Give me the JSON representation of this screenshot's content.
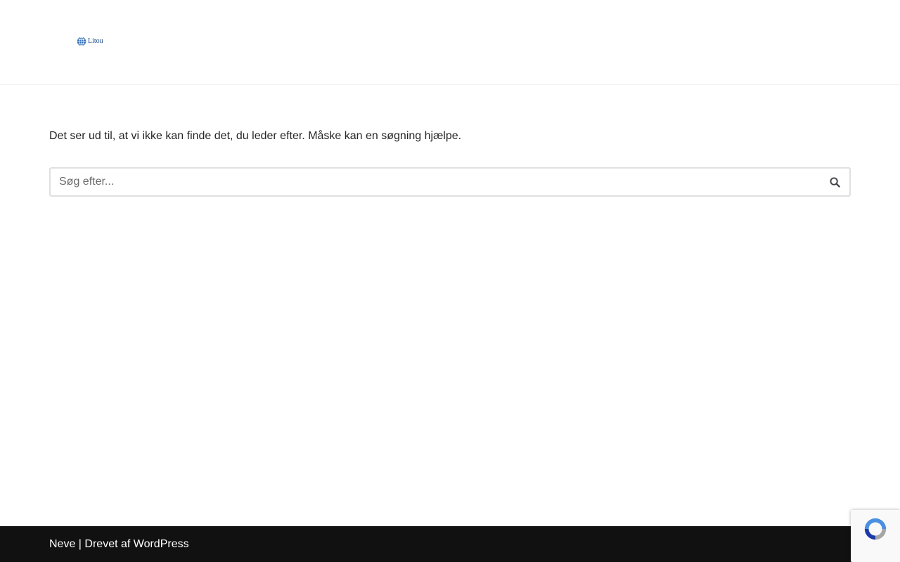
{
  "header": {
    "logo_text": "Litou",
    "logo_color": "#1f4e8c"
  },
  "main": {
    "message": "Det ser ud til, at vi ikke kan finde det, du leder efter. Måske kan en søgning hjælpe.",
    "search": {
      "placeholder": "Søg efter...",
      "value": "",
      "button_icon": "search-icon"
    }
  },
  "footer": {
    "theme_link": "Neve",
    "separator": " | ",
    "powered_prefix": "Drevet af ",
    "wordpress_link": "WordPress",
    "background": "#111111"
  },
  "recaptcha": {
    "icon": "recaptcha-icon",
    "accent": "#4a90e2"
  }
}
